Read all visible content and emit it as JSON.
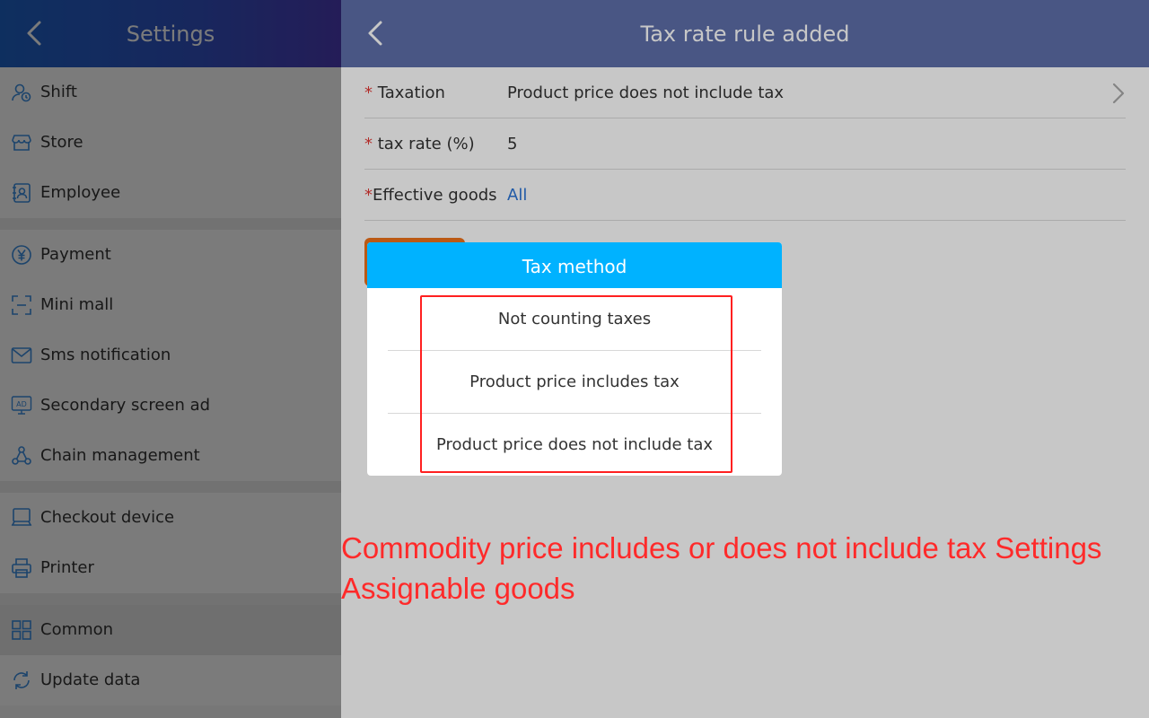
{
  "sidebar": {
    "title": "Settings",
    "groups": [
      [
        {
          "label": "Shift",
          "icon": "user-clock-icon"
        },
        {
          "label": "Store",
          "icon": "store-icon"
        },
        {
          "label": "Employee",
          "icon": "employee-card-icon"
        }
      ],
      [
        {
          "label": "Payment",
          "icon": "yen-circle-icon"
        },
        {
          "label": "Mini mall",
          "icon": "mini-mall-icon"
        },
        {
          "label": "Sms notification",
          "icon": "envelope-icon"
        },
        {
          "label": "Secondary screen ad",
          "icon": "ad-screen-icon"
        },
        {
          "label": "Chain management",
          "icon": "chain-nodes-icon"
        }
      ],
      [
        {
          "label": "Checkout device",
          "icon": "monitor-icon"
        },
        {
          "label": "Printer",
          "icon": "printer-icon"
        }
      ],
      [
        {
          "label": "Common",
          "icon": "grid-icon",
          "active": true
        },
        {
          "label": "Update data",
          "icon": "refresh-icon"
        }
      ]
    ]
  },
  "header": {
    "title": "Tax rate rule added"
  },
  "form": {
    "taxation": {
      "required": "*",
      "label": " Taxation",
      "value": "Product price does not include tax"
    },
    "tax_rate": {
      "required": "*",
      "label": " tax rate (%)",
      "value": "5"
    },
    "effective_goods": {
      "required": "*",
      "label": "Effective goods",
      "value": "All"
    }
  },
  "dialog": {
    "title": "Tax method",
    "options": [
      "Not counting taxes",
      "Product price includes tax",
      "Product price does not include tax"
    ]
  },
  "annotation": {
    "line1": "Commodity price includes or does not include tax Settings",
    "line2": "Assignable goods"
  },
  "colors": {
    "sidebar_header_start": "#1f63c6",
    "sidebar_header_end": "#4c3cb6",
    "main_header": "#5e6fa9",
    "dialog_header": "#00b2ff",
    "required_mark": "#e53935",
    "link": "#2a74d6",
    "save_button": "#f0731a",
    "annotation_red": "#ff2a2a"
  }
}
